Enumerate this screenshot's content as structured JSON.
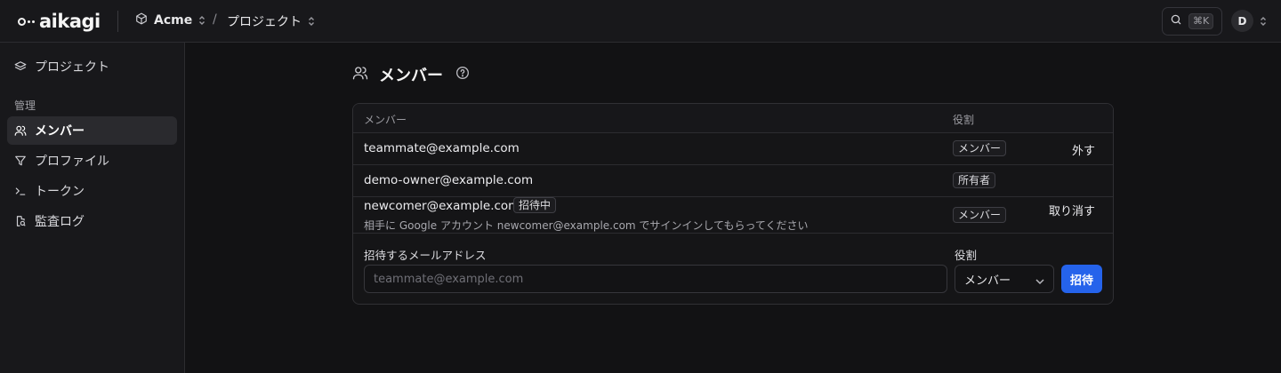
{
  "header": {
    "brand": "aikagi",
    "org": "Acme",
    "separator": "/",
    "project": "プロジェクト",
    "search_shortcut": "⌘K",
    "avatar_initial": "D"
  },
  "sidebar": {
    "items_top": [
      {
        "label": "プロジェクト",
        "icon": "layers-icon"
      }
    ],
    "section_label": "管理",
    "items": [
      {
        "label": "メンバー",
        "icon": "users-icon",
        "active": true
      },
      {
        "label": "プロファイル",
        "icon": "filter-icon",
        "active": false
      },
      {
        "label": "トークン",
        "icon": "terminal-icon",
        "active": false
      },
      {
        "label": "監査ログ",
        "icon": "audit-icon",
        "active": false
      }
    ]
  },
  "main": {
    "title": "メンバー",
    "table": {
      "headers": {
        "member": "メンバー",
        "role": "役割"
      },
      "rows": [
        {
          "email": "teammate@example.com",
          "role": "メンバー",
          "action": "外す"
        },
        {
          "email": "demo-owner@example.com",
          "role": "所有者",
          "action": ""
        },
        {
          "email": "newcomer@example.com",
          "status": "招待中",
          "note": "相手に Google アカウント newcomer@example.com でサインインしてもらってください",
          "role": "メンバー",
          "action": "取り消す"
        }
      ]
    },
    "invite": {
      "email_label": "招待するメールアドレス",
      "email_placeholder": "teammate@example.com",
      "role_label": "役割",
      "role_value": "メンバー",
      "button": "招待"
    }
  },
  "colors": {
    "background": "#121214",
    "panel": "#18181b",
    "accent": "#2563eb"
  }
}
